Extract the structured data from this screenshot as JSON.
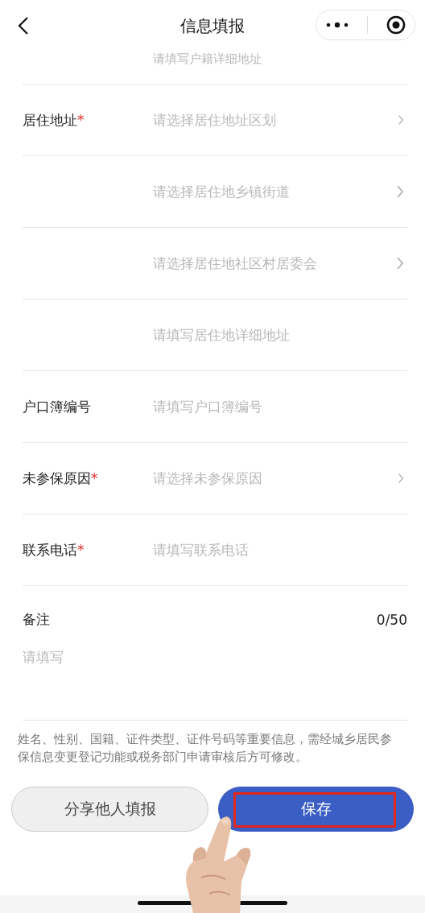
{
  "header": {
    "title": "信息填报"
  },
  "top_row": {
    "placeholder": "请填写户籍详细地址"
  },
  "rows": [
    {
      "label": "居住地址",
      "required_mark": "*",
      "placeholder": "请选择居住地址区划",
      "kind": "select"
    },
    {
      "placeholder": "请选择居住地乡镇街道",
      "kind": "select"
    },
    {
      "placeholder": "请选择居住地社区村居委会",
      "kind": "select"
    },
    {
      "placeholder": "请填写居住地详细地址",
      "kind": "input"
    },
    {
      "label": "户口簿编号",
      "placeholder": "请填写户口簿编号",
      "kind": "input"
    },
    {
      "label": "未参保原因",
      "required_mark": "*",
      "placeholder": "请选择未参保原因",
      "kind": "select"
    },
    {
      "label": "联系电话",
      "required_mark": "*",
      "placeholder": "请填写联系电话",
      "kind": "input"
    }
  ],
  "remarks": {
    "label": "备注",
    "counter": "0/50",
    "placeholder": "请填写"
  },
  "notice": "姓名、性别、国籍、证件类型、证件号码等重要信息，需经城乡居民参保信息变更登记功能或税务部门申请审核后方可修改。",
  "buttons": [
    {
      "label": "分享他人填报",
      "kind": "secondary",
      "highlighted": false
    },
    {
      "label": "保存",
      "kind": "primary",
      "highlighted": true
    }
  ]
}
